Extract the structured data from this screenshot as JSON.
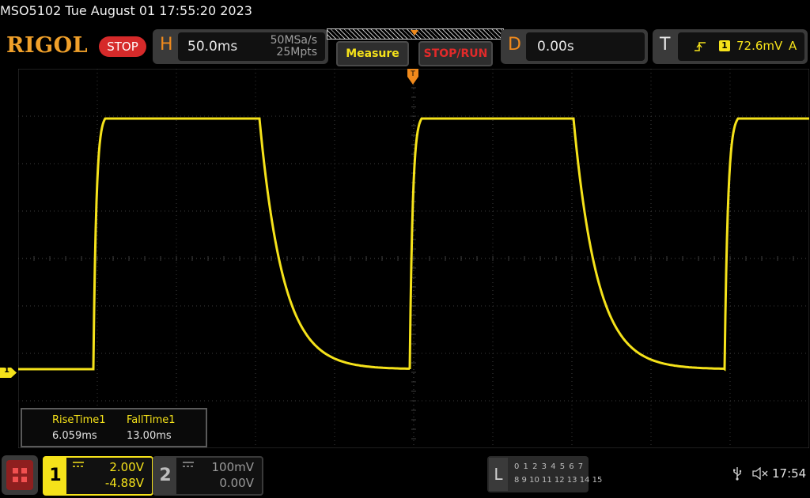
{
  "header": {
    "model_timestamp": "MSO5102  Tue August 01 17:55:20 2023"
  },
  "logo": {
    "text": "RIGOL"
  },
  "run_state": "STOP",
  "horizontal": {
    "letter": "H",
    "timebase": "50.0ms",
    "sample_rate": "50MSa/s",
    "memory_depth": "25Mpts"
  },
  "buttons": {
    "measure": "Measure",
    "stop_run": "STOP/RUN"
  },
  "delay": {
    "letter": "D",
    "value": "0.00s"
  },
  "trigger": {
    "letter": "T",
    "edge_icon": "rising-edge-icon",
    "source": "1",
    "level": "72.6mV",
    "mode": "A"
  },
  "channel1_marker": "1",
  "measurements": [
    {
      "label": "RiseTime1",
      "value": "6.059ms"
    },
    {
      "label": "FallTime1",
      "value": "13.00ms"
    }
  ],
  "channels": [
    {
      "number": "1",
      "coupling_icon": "dc-coupling-icon",
      "scale": "2.00V",
      "offset": "-4.88V",
      "active": true
    },
    {
      "number": "2",
      "coupling_icon": "dc-coupling-icon",
      "scale": "100mV",
      "offset": "0.00V",
      "active": false
    }
  ],
  "logic_analyzer": {
    "letter": "L",
    "row1": "0 1 2 3  4 5 6 7",
    "row2": "8 9 10 11 12 13 14 15"
  },
  "status": {
    "clock": "17:54"
  },
  "colors": {
    "accent_orange": "#f08a1c",
    "channel1": "#f5e21a",
    "stop_red": "#d62a2a",
    "grid": "#3c3c3c"
  }
}
